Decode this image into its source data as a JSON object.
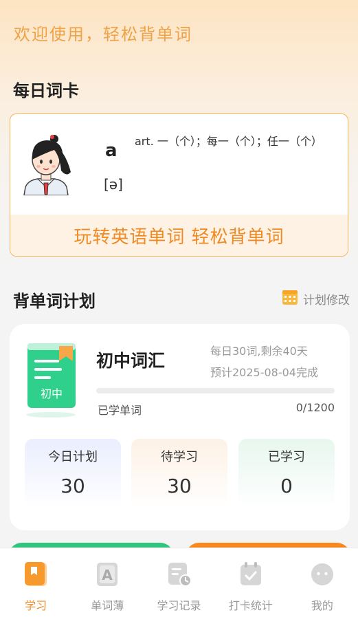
{
  "header": {
    "greeting": "欢迎使用，轻松背单词"
  },
  "daily": {
    "title": "每日词卡",
    "word": "a",
    "meaning": "art. 一（个）；每一（个）；任一（个）",
    "phonetic": "[ə]",
    "slogan": "玩转英语单词  轻松背单词",
    "icons": {
      "avatar": "student-girl-avatar"
    }
  },
  "plan": {
    "title": "背单词计划",
    "edit_label": "计划修改",
    "book_name": "初中词汇",
    "book_cover_label": "初中",
    "daily_info": "每日30词,剩余40天",
    "finish_info": "预计2025-08-04完成",
    "learned_label": "已学单词",
    "learned_count": "0/1200",
    "progress": 0,
    "stats": [
      {
        "label": "今日计划",
        "value": "30"
      },
      {
        "label": "待学习",
        "value": "30"
      },
      {
        "label": "已学习",
        "value": "0"
      }
    ]
  },
  "tabs": [
    {
      "label": "学习",
      "icon": "book-icon",
      "active": true
    },
    {
      "label": "单词薄",
      "icon": "letter-a-icon",
      "active": false
    },
    {
      "label": "学习记录",
      "icon": "record-clock-icon",
      "active": false
    },
    {
      "label": "打卡统计",
      "icon": "calendar-check-icon",
      "active": false
    },
    {
      "label": "我的",
      "icon": "user-face-icon",
      "active": false
    }
  ],
  "colors": {
    "accent": "#f08a24",
    "green": "#30c47e",
    "orange": "#f7871f"
  }
}
